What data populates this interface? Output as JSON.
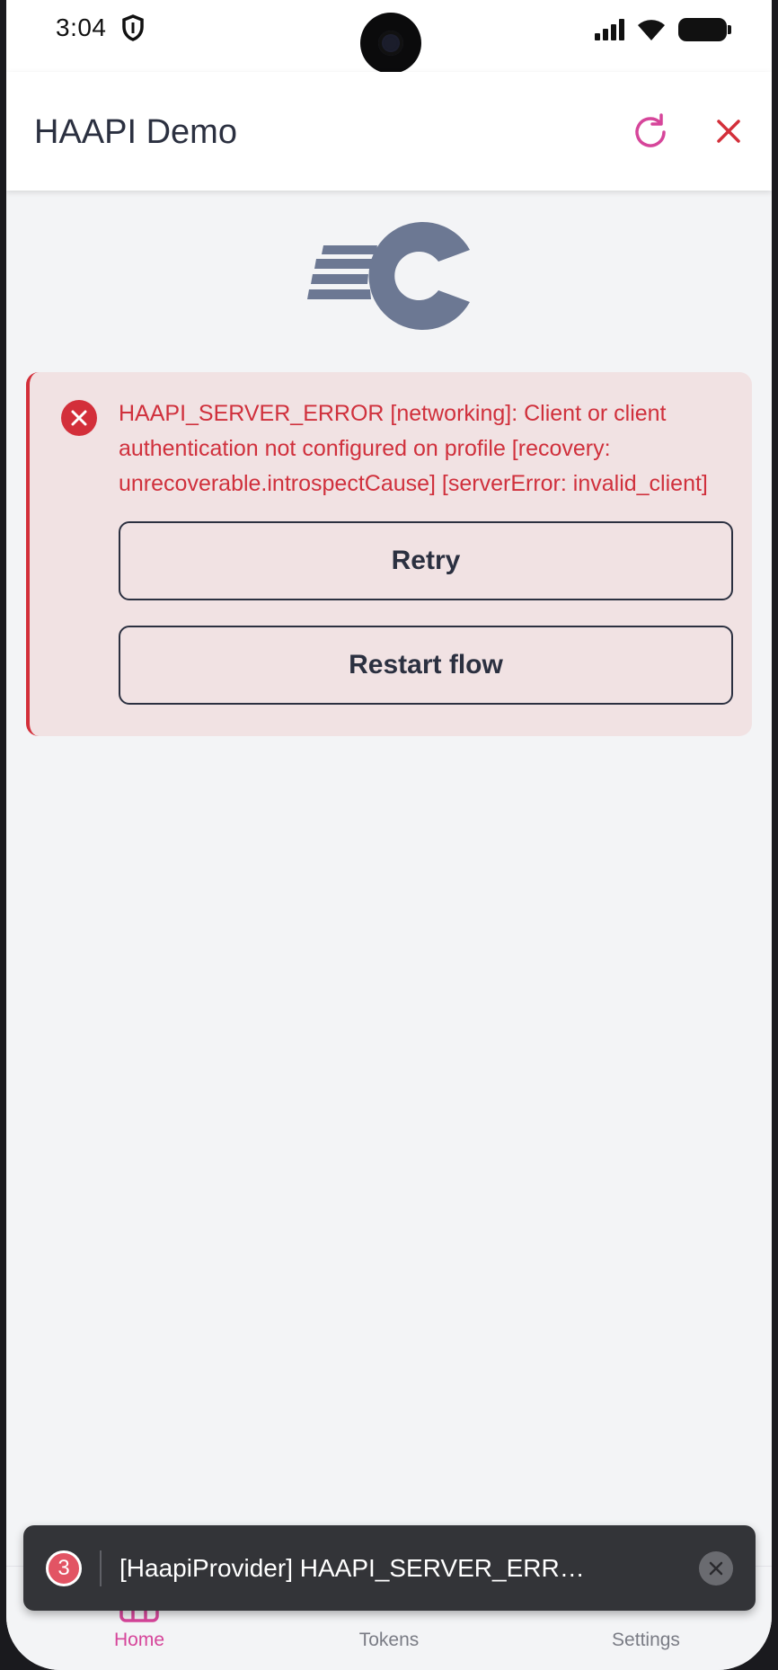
{
  "status_bar": {
    "time": "3:04",
    "icons": [
      "shield-icon",
      "signal-icon",
      "wifi-icon",
      "battery-icon"
    ]
  },
  "app_bar": {
    "title": "HAAPI Demo",
    "reload_icon": "reload-icon",
    "close_icon": "close-icon"
  },
  "colors": {
    "accent": "#d6459a",
    "error": "#d32f3a",
    "error_background": "#f1e2e3",
    "text_dark": "#2b3040",
    "logo": "#6c7893"
  },
  "error_card": {
    "message": "HAAPI_SERVER_ERROR [networking]: Client or client authentication not configured on profile [recovery: unrecoverable.introspectCause] [serverError: invalid_client]",
    "retry_label": "Retry",
    "restart_label": "Restart flow"
  },
  "snackbar": {
    "count": "3",
    "text": "[HaapiProvider] HAAPI_SERVER_ERROR [networking]: Client or client authentication not configured on profile"
  },
  "bottom_nav": {
    "items": [
      {
        "label": "Home",
        "icon": "home-icon",
        "active": true
      },
      {
        "label": "Tokens",
        "icon": "tokens-icon",
        "active": false
      },
      {
        "label": "Settings",
        "icon": "settings-icon",
        "active": false
      }
    ]
  }
}
